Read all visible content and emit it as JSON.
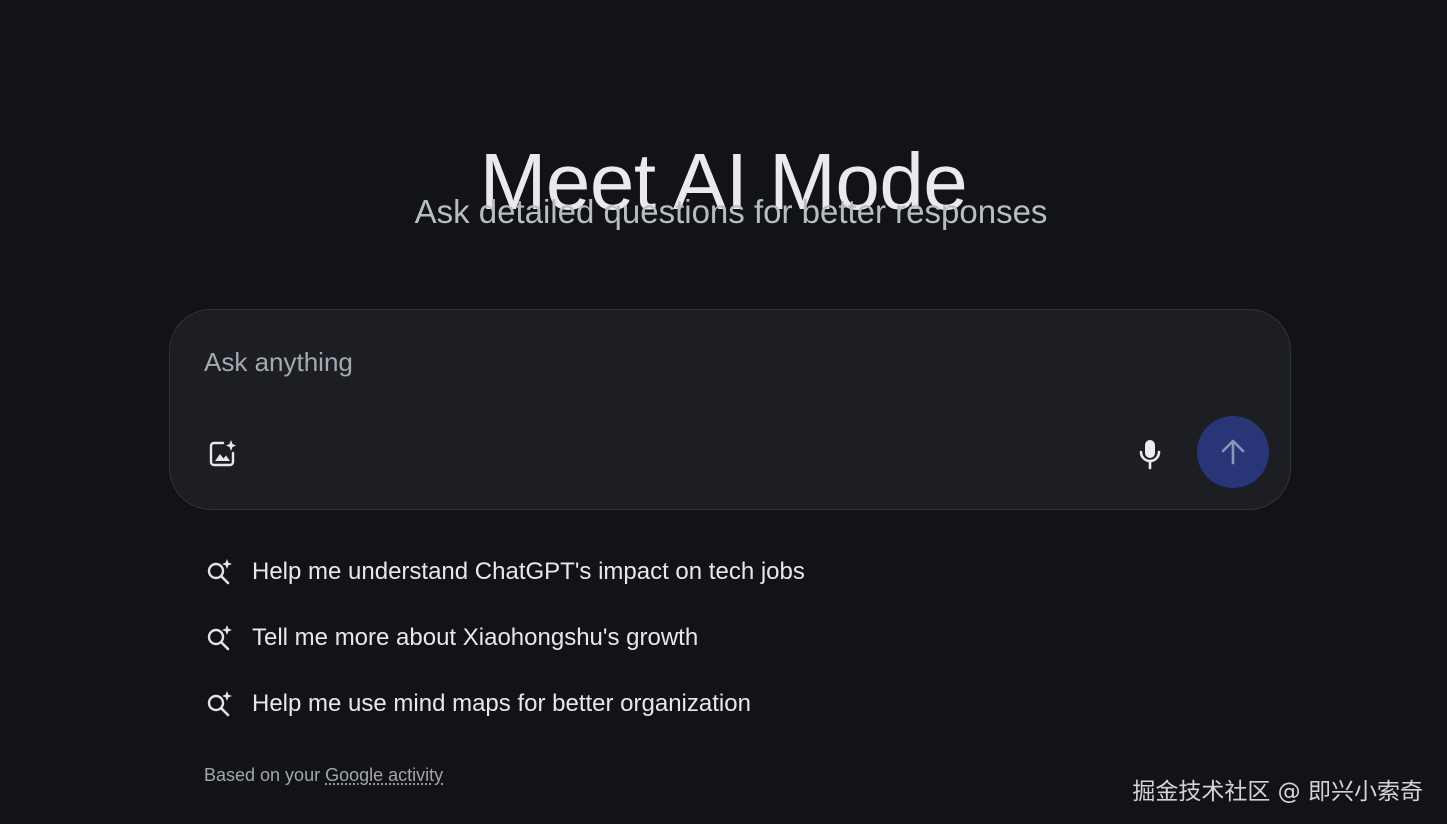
{
  "hero": {
    "title": "Meet AI Mode",
    "subtitle": "Ask detailed questions for better responses"
  },
  "search": {
    "placeholder": "Ask anything",
    "value": "",
    "image_icon": "image-sparkle-icon",
    "mic_icon": "microphone-icon",
    "send_icon": "arrow-up-icon"
  },
  "suggestions": [
    {
      "text": "Help me understand ChatGPT's impact on tech jobs",
      "icon": "search-sparkle-icon"
    },
    {
      "text": "Tell me more about Xiaohongshu's growth",
      "icon": "search-sparkle-icon"
    },
    {
      "text": "Help me use mind maps for better organization",
      "icon": "search-sparkle-icon"
    }
  ],
  "footer": {
    "prefix": "Based on your ",
    "link": "Google activity"
  },
  "watermark": "掘金技术社区 @ 即兴小索奇",
  "colors": {
    "background": "#121317",
    "search_box": "#1d1e24",
    "send_button": "#283678",
    "send_arrow": "#8c94bc",
    "text": "#e3e3e8",
    "muted_text": "#a3a5ad"
  }
}
